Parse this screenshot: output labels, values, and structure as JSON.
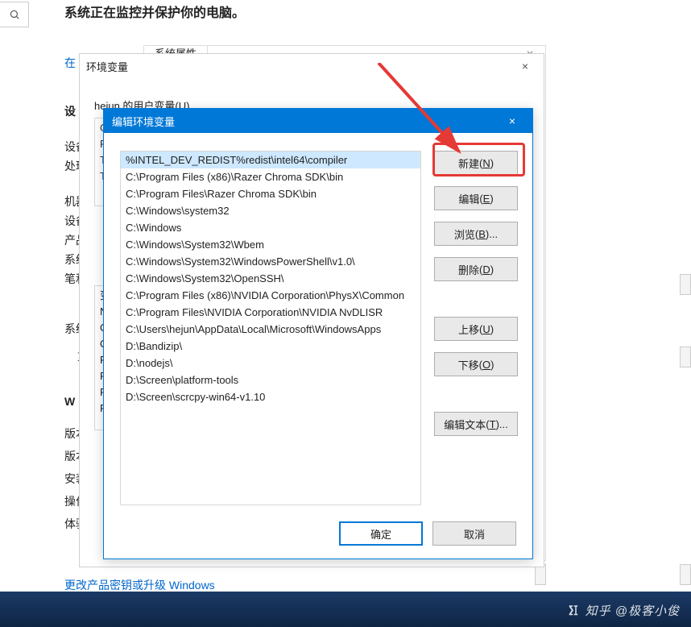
{
  "status": {
    "text": "系统正在监控并保护你的电脑。"
  },
  "background": {
    "tab_label": "系统属性",
    "left_fragments": {
      "l1": "在",
      "l2": "设",
      "l3": "设备",
      "l4": "处理",
      "l5": "机器",
      "l6": "设备",
      "l7": "产品",
      "l8": "系统",
      "l9": "笔和",
      "l10": "系统",
      "l11": "重",
      "l12": "W",
      "l13": "版本",
      "l14": "版本",
      "l15": "安装",
      "l16": "操作",
      "l17": "体验"
    },
    "user_var_labels": [
      "O",
      "P",
      "T",
      "T"
    ],
    "sys_var_labels": [
      "变",
      "N",
      "O",
      "O",
      "P",
      "P",
      "P",
      "P"
    ]
  },
  "outer_dialog": {
    "title": "环境变量",
    "user_section_label_pre": "hejun 的用户变量(",
    "user_section_label_key": "U",
    "user_section_label_post": ")"
  },
  "inner_dialog": {
    "title": "编辑环境变量",
    "paths": [
      "%INTEL_DEV_REDIST%redist\\intel64\\compiler",
      "C:\\Program Files (x86)\\Razer Chroma SDK\\bin",
      "C:\\Program Files\\Razer Chroma SDK\\bin",
      "C:\\Windows\\system32",
      "C:\\Windows",
      "C:\\Windows\\System32\\Wbem",
      "C:\\Windows\\System32\\WindowsPowerShell\\v1.0\\",
      "C:\\Windows\\System32\\OpenSSH\\",
      "C:\\Program Files (x86)\\NVIDIA Corporation\\PhysX\\Common",
      "C:\\Program Files\\NVIDIA Corporation\\NVIDIA NvDLISR",
      "C:\\Users\\hejun\\AppData\\Local\\Microsoft\\WindowsApps",
      "D:\\Bandizip\\",
      "D:\\nodejs\\",
      "D:\\Screen\\platform-tools",
      "D:\\Screen\\scrcpy-win64-v1.10"
    ],
    "buttons": {
      "new": {
        "label": "新建",
        "key": "N"
      },
      "edit": {
        "label": "编辑",
        "key": "E"
      },
      "browse": {
        "label": "浏览",
        "key": "B",
        "suffix": "..."
      },
      "delete": {
        "label": "删除",
        "key": "D"
      },
      "moveup": {
        "label": "上移",
        "key": "U"
      },
      "movedn": {
        "label": "下移",
        "key": "O"
      },
      "edittxt": {
        "label": "编辑文本",
        "key": "T",
        "suffix": "..."
      },
      "ok": {
        "label": "确定"
      },
      "cancel": {
        "label": "取消"
      }
    }
  },
  "bottom_link": {
    "text": "更改产品密钥或升级 Windows"
  },
  "watermark": {
    "text": "知乎 @极客小俊"
  }
}
